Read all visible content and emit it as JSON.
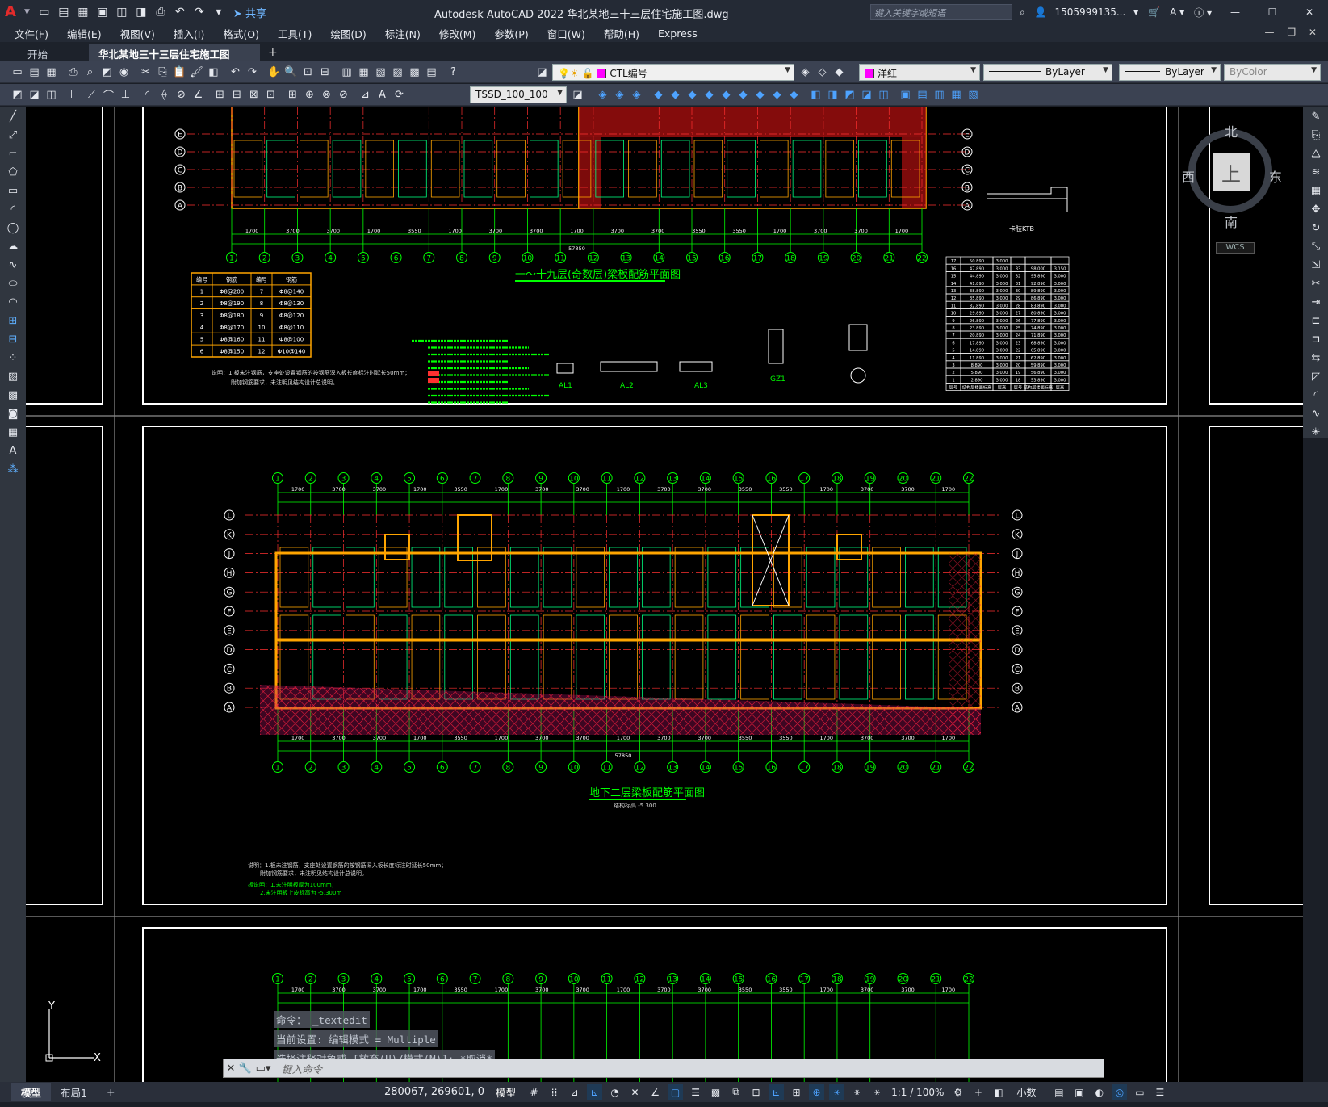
{
  "app": {
    "title": "Autodesk AutoCAD 2022    华北某地三十三层住宅施工图.dwg",
    "search_placeholder": "键入关键字或短语",
    "user": "1505999135...",
    "share": "共享"
  },
  "menu": [
    "文件(F)",
    "编辑(E)",
    "视图(V)",
    "插入(I)",
    "格式(O)",
    "工具(T)",
    "绘图(D)",
    "标注(N)",
    "修改(M)",
    "参数(P)",
    "窗口(W)",
    "帮助(H)",
    "Express"
  ],
  "tabs": {
    "start": "开始",
    "active": "华北某地三十三层住宅施工图*"
  },
  "properties": {
    "layer": "CTL编号",
    "color": "洋红",
    "linetype": "ByLayer",
    "lineweight": "ByLayer",
    "plotstyle": "ByColor",
    "dimstyle": "TSSD_100_100"
  },
  "viewcube": {
    "north": "北",
    "south": "南",
    "west": "西",
    "east": "东",
    "face": "上",
    "wcs": "WCS"
  },
  "drawing": {
    "plan1_title": "一～十九层(奇数层)梁板配筋平面图",
    "plan2_title": "地下二层梁板配筋平面图",
    "plan2_sub": "结构标高 -5.300",
    "detail_label": "卡肢KTB",
    "sections": [
      "AL1",
      "AL2",
      "AL3",
      "GZ1"
    ],
    "overall_dim": "57850",
    "axes_bottom": [
      "1",
      "2",
      "3",
      "4",
      "5",
      "6",
      "7",
      "8",
      "9",
      "10",
      "11",
      "12",
      "13",
      "14",
      "15",
      "16",
      "17",
      "18",
      "19",
      "20",
      "21",
      "22"
    ],
    "axes_left": [
      "A",
      "B",
      "C",
      "D",
      "E",
      "F",
      "G",
      "H",
      "J",
      "K",
      "L"
    ],
    "spans": [
      "1700",
      "3700",
      "3700",
      "1700",
      "3550",
      "1700",
      "3700",
      "3700",
      "1700",
      "3700",
      "3700",
      "3550",
      "3550",
      "1700",
      "3700",
      "3700",
      "1700"
    ],
    "note1": "说明：1.板未注钢筋，支座处设置钢筋的按钢筋深入板长度标注时延长50mm；",
    "note2": "附加钢筋要求，未注明见结构设计总说明。",
    "note3": "板说明：1.未注明板厚为100mm；",
    "note4": "2.未注明板上皮标高为 -5.300m",
    "rebar_table": {
      "headers": [
        "编号",
        "钢筋",
        "编号",
        "钢筋"
      ],
      "rows": [
        [
          "1",
          "Φ8@200",
          "7",
          "Φ8@140"
        ],
        [
          "2",
          "Φ8@190",
          "8",
          "Φ8@130"
        ],
        [
          "3",
          "Φ8@180",
          "9",
          "Φ8@120"
        ],
        [
          "4",
          "Φ8@170",
          "10",
          "Φ8@110"
        ],
        [
          "5",
          "Φ8@160",
          "11",
          "Φ8@100"
        ],
        [
          "6",
          "Φ8@150",
          "12",
          "Φ10@140"
        ]
      ]
    },
    "floor_table": {
      "rows": [
        [
          "17",
          "50.890",
          "3.000",
          "",
          "",
          ""
        ],
        [
          "16",
          "47.890",
          "3.000",
          "33",
          "98.000",
          "3.150"
        ],
        [
          "15",
          "44.890",
          "3.000",
          "32",
          "95.890",
          "3.000"
        ],
        [
          "14",
          "41.890",
          "3.000",
          "31",
          "92.890",
          "3.000"
        ],
        [
          "13",
          "38.890",
          "3.000",
          "30",
          "89.890",
          "3.000"
        ],
        [
          "12",
          "35.890",
          "3.000",
          "29",
          "86.890",
          "3.000"
        ],
        [
          "11",
          "32.890",
          "3.000",
          "28",
          "83.890",
          "3.000"
        ],
        [
          "10",
          "29.890",
          "3.000",
          "27",
          "80.890",
          "3.000"
        ],
        [
          "9",
          "26.890",
          "3.000",
          "26",
          "77.890",
          "3.000"
        ],
        [
          "8",
          "23.890",
          "3.000",
          "25",
          "74.890",
          "3.000"
        ],
        [
          "7",
          "20.890",
          "3.000",
          "24",
          "71.890",
          "3.000"
        ],
        [
          "6",
          "17.890",
          "3.000",
          "23",
          "68.890",
          "3.000"
        ],
        [
          "5",
          "14.890",
          "3.000",
          "22",
          "65.890",
          "3.000"
        ],
        [
          "4",
          "11.890",
          "3.000",
          "21",
          "62.890",
          "3.000"
        ],
        [
          "3",
          "8.890",
          "3.000",
          "20",
          "59.890",
          "3.000"
        ],
        [
          "2",
          "5.890",
          "3.000",
          "19",
          "56.890",
          "3.000"
        ],
        [
          "1",
          "2.890",
          "3.000",
          "18",
          "53.890",
          "3.000"
        ]
      ],
      "footer": [
        "层号",
        "结构层楼面标高",
        "层高",
        "层号",
        "结构层楼面标高",
        "层高"
      ]
    }
  },
  "command": {
    "history": [
      "命令： _textedit",
      "当前设置: 编辑模式 = Multiple",
      "选择注释对象或 [放弃(U)/模式(M)]: *取消*"
    ],
    "placeholder": "键入命令"
  },
  "layout_tabs": [
    "模型",
    "布局1"
  ],
  "status": {
    "coords": "280067, 269601, 0",
    "model": "模型",
    "scale": "1:1 / 100%",
    "units": "小数"
  }
}
